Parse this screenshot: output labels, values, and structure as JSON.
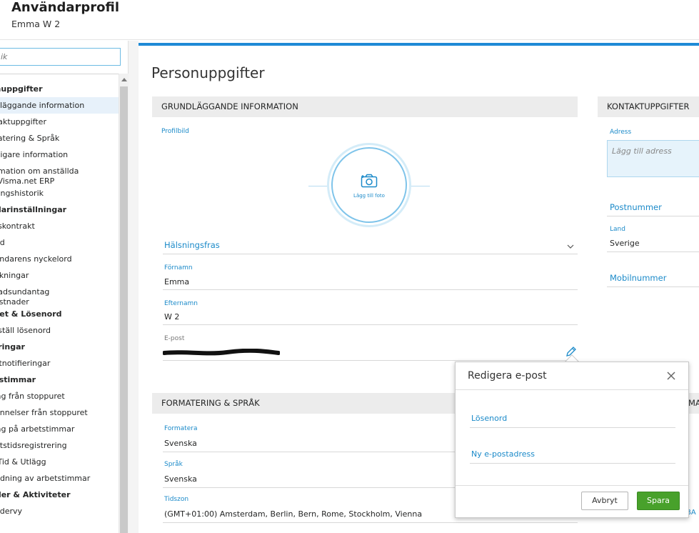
{
  "header": {
    "title": "Användarprofil",
    "subtitle": "Emma W 2"
  },
  "sidebar": {
    "search_placeholder": "ik",
    "items": [
      {
        "label": "onuppgifter",
        "type": "head"
      },
      {
        "label": "ndläggande information",
        "type": "item",
        "active": true
      },
      {
        "label": "ntaktuppgifter",
        "type": "item"
      },
      {
        "label": "matering & Språk",
        "type": "item"
      },
      {
        "label": "erligare information",
        "type": "item"
      },
      {
        "label": "ormation om anställda",
        "label2": "n Visma.net ERP",
        "type": "item"
      },
      {
        "label": "dringshistorik",
        "type": "item"
      },
      {
        "label": "ndarinställningar",
        "type": "head"
      },
      {
        "label": "etskontrakt",
        "type": "item"
      },
      {
        "label": "ktid",
        "type": "item"
      },
      {
        "label": "vändarens nyckelord",
        "type": "item"
      },
      {
        "label": "eckningar",
        "type": "item"
      },
      {
        "label": "tnadsundantag",
        "label2": "kostnader",
        "type": "item"
      },
      {
        "label": "rhet & Lösenord",
        "type": "head"
      },
      {
        "label": "erställ lösenord",
        "type": "item"
      },
      {
        "label": "ieringar",
        "type": "head"
      },
      {
        "label": "ostnotifieringar",
        "type": "item"
      },
      {
        "label": "etstimmar",
        "type": "head"
      },
      {
        "label": "slag från stoppuret",
        "type": "item"
      },
      {
        "label": "minnelser från stoppuret",
        "type": "item"
      },
      {
        "label": "slag på arbetstimmar",
        "type": "item"
      },
      {
        "label": "betstidsregistrering",
        "type": "item"
      },
      {
        "label": "n Tid & Utlägg",
        "type": "item"
      },
      {
        "label": "undning av arbetstimmar",
        "type": "item"
      },
      {
        "label": "nder & Aktiviteter",
        "type": "head"
      },
      {
        "label": "endervy",
        "type": "item"
      }
    ]
  },
  "main": {
    "page_title": "Personuppgifter",
    "basic": {
      "heading": "GRUNDLÄGGANDE INFORMATION",
      "photo_label": "Profilbild",
      "add_photo": "Lägg till foto",
      "greeting_label": "Hälsningsfras",
      "firstname_label": "Förnamn",
      "firstname_value": "Emma",
      "lastname_label": "Efternamn",
      "lastname_value": "W 2",
      "email_label": "E-post"
    },
    "contact": {
      "heading": "KONTAKTUPPGIFTER",
      "address_label": "Adress",
      "address_placeholder": "Lägg till adress",
      "postal_label": "Postnummer",
      "country_label": "Land",
      "country_value": "Sverige",
      "mobile_label": "Mobilnummer"
    },
    "format": {
      "heading": "FORMATERING & SPRÅK",
      "format_label": "Formatera",
      "format_value": "Svenska",
      "language_label": "Språk",
      "language_value": "Svenska",
      "timezone_label": "Tidszon",
      "timezone_value": "(GMT+01:00) Amsterdam, Berlin, Bern, Rome, Stockholm, Vienna"
    },
    "edge_texts": {
      "right_head": "MA",
      "right_bottom": "BA"
    }
  },
  "dialog": {
    "title": "Redigera e-post",
    "password_label": "Lösenord",
    "new_email_label": "Ny e-postadress",
    "cancel_label": "Avbryt",
    "save_label": "Spara"
  },
  "colors": {
    "accent": "#1e8ad6",
    "link": "#1b8ac9",
    "save": "#48a12b"
  }
}
